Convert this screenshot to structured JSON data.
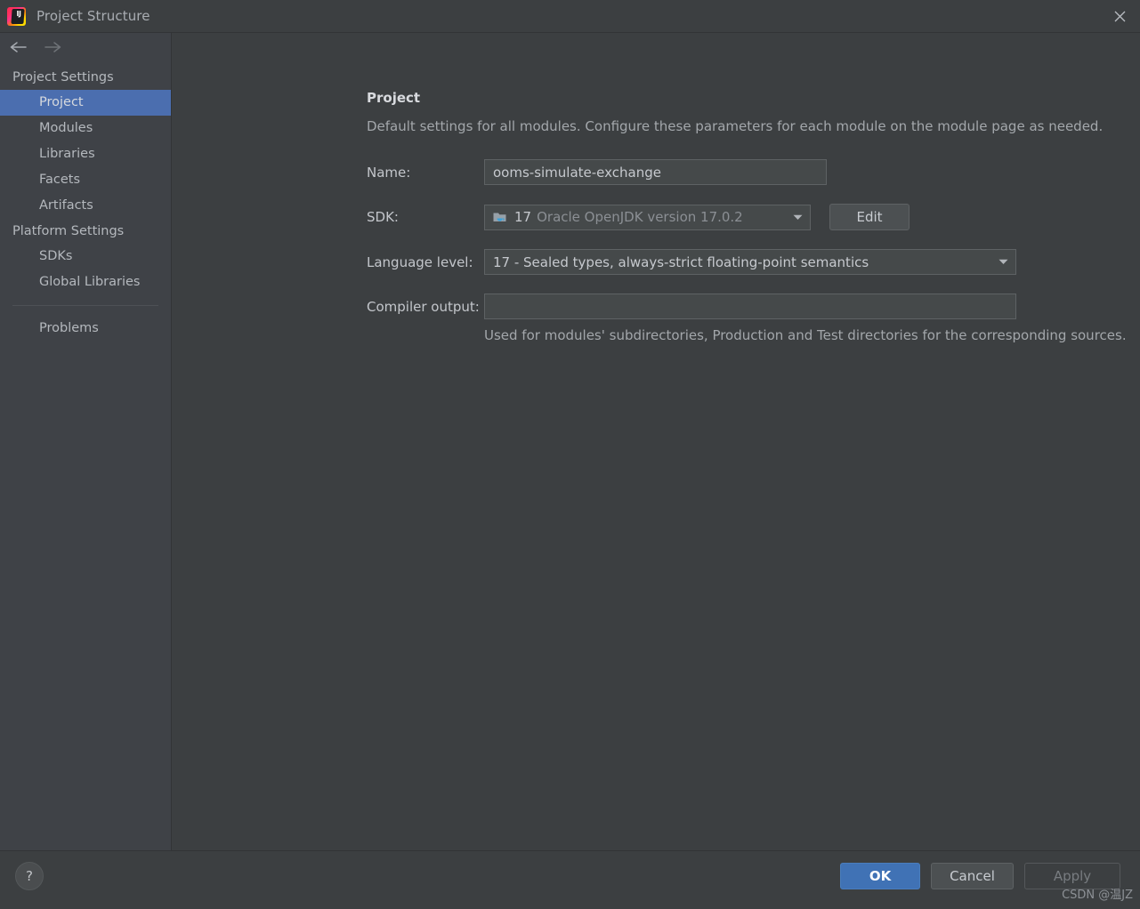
{
  "window": {
    "title": "Project Structure",
    "logo_icon": "intellij-idea-logo",
    "close_icon": "close-icon"
  },
  "navigation": {
    "back_icon": "arrow-left-icon",
    "forward_icon": "arrow-right-icon"
  },
  "sidebar": {
    "groups": [
      {
        "label": "Project Settings",
        "items": [
          {
            "label": "Project",
            "selected": true
          },
          {
            "label": "Modules",
            "selected": false
          },
          {
            "label": "Libraries",
            "selected": false
          },
          {
            "label": "Facets",
            "selected": false
          },
          {
            "label": "Artifacts",
            "selected": false
          }
        ]
      },
      {
        "label": "Platform Settings",
        "items": [
          {
            "label": "SDKs",
            "selected": false
          },
          {
            "label": "Global Libraries",
            "selected": false
          }
        ]
      }
    ],
    "extra_items": [
      {
        "label": "Problems",
        "selected": false
      }
    ]
  },
  "main": {
    "title": "Project",
    "subtitle": "Default settings for all modules. Configure these parameters for each module on the module page as needed.",
    "fields": {
      "name": {
        "label": "Name:",
        "value": "ooms-simulate-exchange",
        "placeholder": ""
      },
      "sdk": {
        "label": "SDK:",
        "icon": "java-sdk-folder-icon",
        "version": "17",
        "description": "Oracle OpenJDK version 17.0.2",
        "dropdown_icon": "chevron-down-icon",
        "edit_label": "Edit"
      },
      "language_level": {
        "label": "Language level:",
        "value": "17 - Sealed types, always-strict floating-point semantics",
        "dropdown_icon": "chevron-down-icon"
      },
      "compiler_output": {
        "label": "Compiler output:",
        "value": "",
        "browse_icon": "folder-browse-icon",
        "hint": "Used for modules' subdirectories, Production and Test directories for the corresponding sources."
      }
    }
  },
  "footer": {
    "help_label": "?",
    "ok_label": "OK",
    "cancel_label": "Cancel",
    "apply_label": "Apply"
  },
  "watermark": {
    "text": "CSDN @温JZ"
  },
  "colors": {
    "dialog_background": "#3c3f41",
    "sidebar_background": "#3f4247",
    "selection_blue": "#4b6eaf",
    "primary_button": "#4072b5",
    "field_background": "#45494a",
    "field_border": "#5e6264",
    "text_primary": "#c6c9ce",
    "text_secondary": "#a3a7ab"
  }
}
